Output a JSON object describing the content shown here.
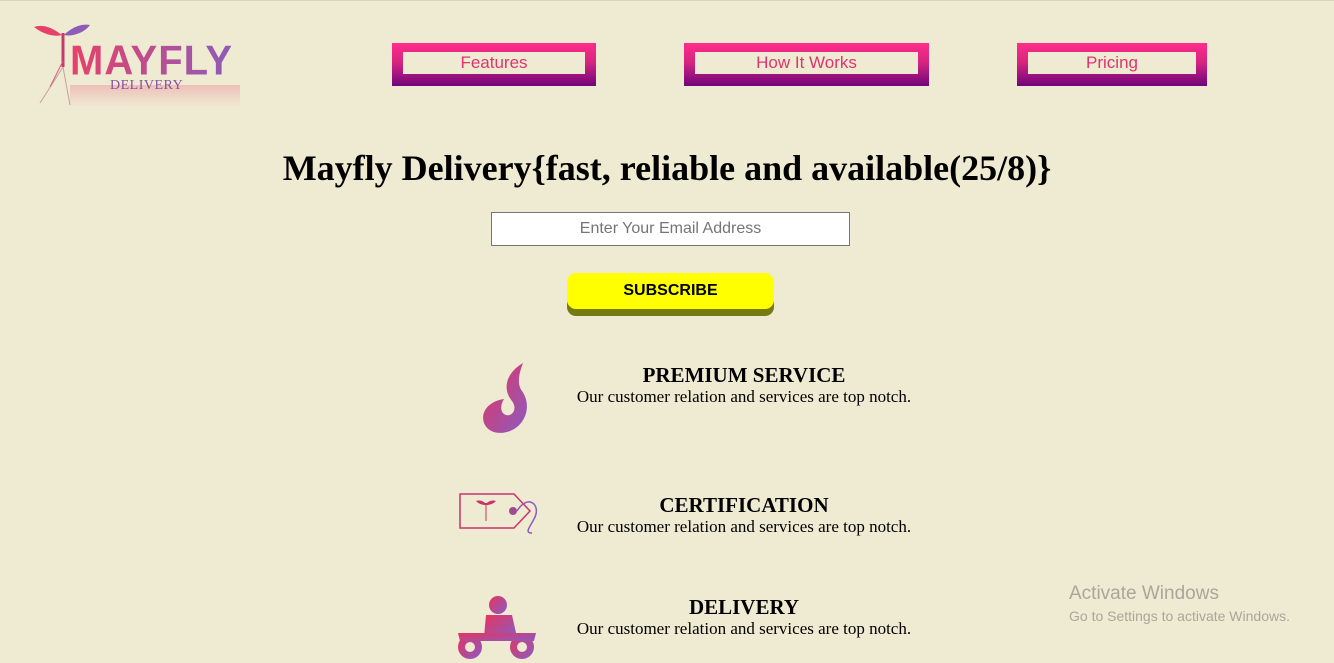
{
  "brand": {
    "name": "MAYFLY",
    "sub": "DELIVERY"
  },
  "nav": [
    {
      "label": "Features"
    },
    {
      "label": "How It Works"
    },
    {
      "label": "Pricing"
    }
  ],
  "hero": {
    "title": "Mayfly Delivery{fast, reliable and available(25/8)}",
    "email_placeholder": "Enter Your Email Address",
    "email_value": "",
    "subscribe_label": "SUBSCRIBE"
  },
  "features": [
    {
      "icon": "flame-icon",
      "title": "PREMIUM SERVICE",
      "text": "Our customer relation and services are top notch."
    },
    {
      "icon": "certificate-tag-icon",
      "title": "CERTIFICATION",
      "text": "Our customer relation and services are top notch."
    },
    {
      "icon": "delivery-bike-icon",
      "title": "DELIVERY",
      "text": "Our customer relation and services are top notch."
    }
  ],
  "watermark": {
    "title": "Activate Windows",
    "text": "Go to Settings to activate Windows."
  },
  "colors": {
    "background": "#efead2",
    "accent_pink": "#e0336f",
    "accent_purple": "#70057c",
    "subscribe": "#ffff00"
  }
}
